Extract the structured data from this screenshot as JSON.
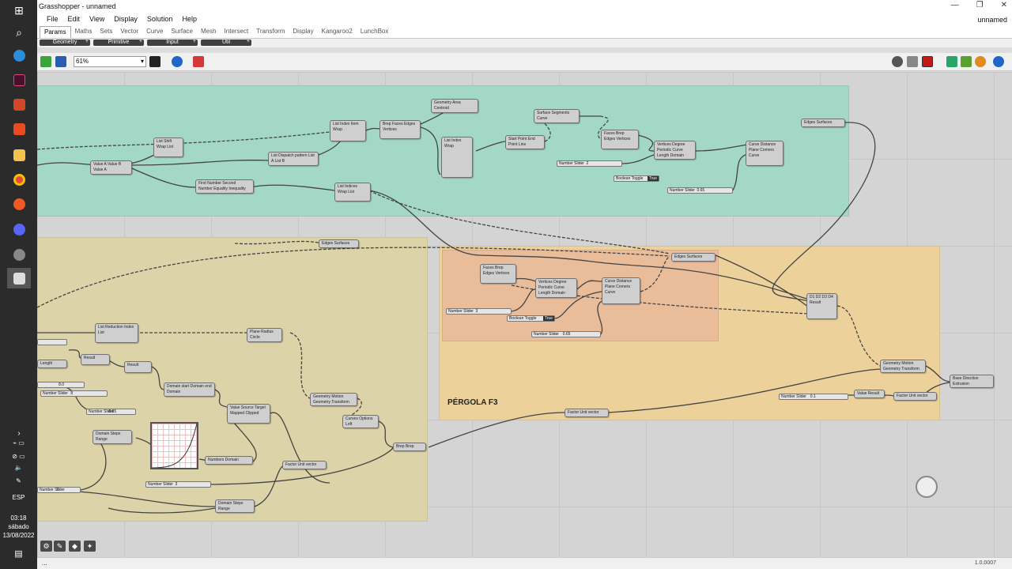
{
  "window": {
    "title": "Grasshopper - unnamed",
    "doc_title": "unnamed",
    "controls": [
      "—",
      "❐",
      "✕"
    ]
  },
  "menu": [
    "File",
    "Edit",
    "View",
    "Display",
    "Solution",
    "Help"
  ],
  "tabs": [
    "Params",
    "Maths",
    "Sets",
    "Vector",
    "Curve",
    "Surface",
    "Mesh",
    "Intersect",
    "Transform",
    "Display",
    "Kangaroo2",
    "LunchBox"
  ],
  "subtabs": [
    "Geometry",
    "Primitive",
    "Input",
    "Util"
  ],
  "toolbar": {
    "zoom": "61%"
  },
  "taskbar": {
    "lang": "ESP",
    "time": "03:18",
    "day": "sábado",
    "date": "13/08/2022"
  },
  "status": {
    "left": "...",
    "right": "1.0.0007"
  },
  "canvas": {
    "group_label": "PÉRGOLA F3",
    "components": [
      {
        "id": "c1",
        "label": "Geometry  Area  Centroid"
      },
      {
        "id": "c2",
        "label": "Surface  Segments  Curve"
      },
      {
        "id": "c3",
        "label": "List  Index  Item  Wrap"
      },
      {
        "id": "c4",
        "label": "Brep  Faces  Edges  Vertices"
      },
      {
        "id": "c5",
        "label": "List  Index  Wrap"
      },
      {
        "id": "c6",
        "label": "Start Point  End Point  Line"
      },
      {
        "id": "c7",
        "label": "Faces  Brep  Edges  Vertices"
      },
      {
        "id": "c8",
        "label": "Vertices  Degree  Periodic  Curve  Length  Domain"
      },
      {
        "id": "c9",
        "label": "Curve  Distance  Plane  Corners  Curve"
      },
      {
        "id": "c10",
        "label": "Edges  Surfaces"
      },
      {
        "id": "c11",
        "label": "List  Shift  Wrap  List"
      },
      {
        "id": "c12",
        "label": "Value A  Value B  Value A"
      },
      {
        "id": "c13",
        "label": "List  Dispatch pattern  List A  List B"
      },
      {
        "id": "c14",
        "label": "First Number  Second Number  Equality  Inequality"
      },
      {
        "id": "c15",
        "label": "List  Indices  Wrap  List"
      },
      {
        "id": "c16",
        "label": "Edges  Surfaces"
      },
      {
        "id": "c17",
        "label": "Edges  Surfaces"
      },
      {
        "id": "c18",
        "label": "Faces  Brep  Edges  Vertices"
      },
      {
        "id": "c19",
        "label": "Vertices  Degree  Periodic  Curve  Length  Domain"
      },
      {
        "id": "c20",
        "label": "Curve  Distance  Plane  Corners  Curve"
      },
      {
        "id": "c21",
        "label": "D1 D2 D3 D4  Result"
      },
      {
        "id": "c22",
        "label": "Geometry  Motion  Geometry  Transform"
      },
      {
        "id": "c23",
        "label": "Base  Direction  Extrusion"
      },
      {
        "id": "c24",
        "label": "Value  Result"
      },
      {
        "id": "c25",
        "label": "Factor  Unit vector"
      },
      {
        "id": "c26",
        "label": "Factor  Unit vector"
      },
      {
        "id": "c27",
        "label": "List  Reduction  Index  List"
      },
      {
        "id": "c28",
        "label": "Plane  Radius  Circle"
      },
      {
        "id": "c29",
        "label": "Result"
      },
      {
        "id": "c30",
        "label": "Length"
      },
      {
        "id": "c31",
        "label": "Result"
      },
      {
        "id": "c32",
        "label": "Domain start  Domain end  Domain"
      },
      {
        "id": "c33",
        "label": "Geometry  Motion  Geometry  Transform"
      },
      {
        "id": "c34",
        "label": "Curves  Options  Loft"
      },
      {
        "id": "c35",
        "label": "Domain  Steps  Range"
      },
      {
        "id": "c36",
        "label": "Value  Source  Target  Mapped  Clipped"
      },
      {
        "id": "c37",
        "label": "Numbers  Domain"
      },
      {
        "id": "c38",
        "label": "Factor  Unit vector"
      },
      {
        "id": "c39",
        "label": "Domain  Steps  Range"
      },
      {
        "id": "c40",
        "label": "Brep  Brep"
      }
    ],
    "sliders": [
      {
        "id": "s1",
        "label": "Number Slider",
        "value": "2"
      },
      {
        "id": "s2",
        "label": "Number Slider",
        "value": "0.65"
      },
      {
        "id": "s3",
        "label": "Number Slider",
        "value": "3"
      },
      {
        "id": "s4",
        "label": "Number Slider",
        "value": "0.65"
      },
      {
        "id": "s5",
        "label": "Number Slider",
        "value": "0.1"
      },
      {
        "id": "s6",
        "label": "Number Slider",
        "value": "0.65"
      },
      {
        "id": "s7",
        "label": "Number Slider",
        "value": "3"
      },
      {
        "id": "s8",
        "label": "Number Slider",
        "value": "8"
      },
      {
        "id": "s9",
        "label": "",
        "value": "8.0"
      },
      {
        "id": "s10",
        "label": "Number Slider",
        "value": "0"
      }
    ],
    "toggles": [
      {
        "id": "t1",
        "label": "Boolean Toggle",
        "value": "True"
      },
      {
        "id": "t2",
        "label": "Boolean Toggle",
        "value": "True"
      }
    ]
  }
}
